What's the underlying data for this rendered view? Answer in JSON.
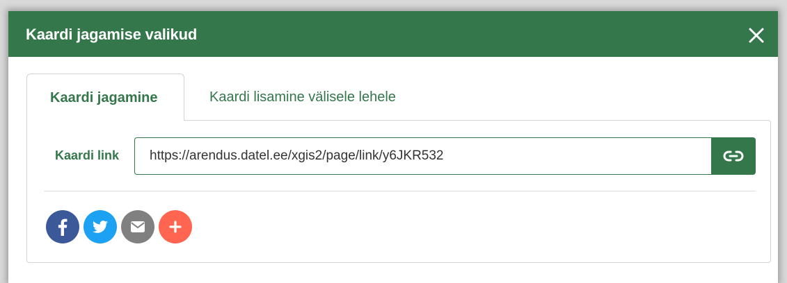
{
  "dialog": {
    "title": "Kaardi jagamise valikud",
    "close_icon": "close-icon"
  },
  "tabs": [
    {
      "label": "Kaardi jagamine",
      "active": true
    },
    {
      "label": "Kaardi lisamine välisele lehele",
      "active": false
    }
  ],
  "link": {
    "label": "Kaardi link",
    "value": "https://arendus.datel.ee/xgis2/page/link/y6JKR532",
    "button_icon": "link-icon"
  },
  "share_buttons": [
    {
      "icon": "facebook-icon",
      "color": "#3b5998"
    },
    {
      "icon": "twitter-icon",
      "color": "#1da1f2"
    },
    {
      "icon": "email-icon",
      "color": "#808080"
    },
    {
      "icon": "plus-icon",
      "color": "#ff6550"
    }
  ],
  "colors": {
    "accent": "#33774b"
  }
}
